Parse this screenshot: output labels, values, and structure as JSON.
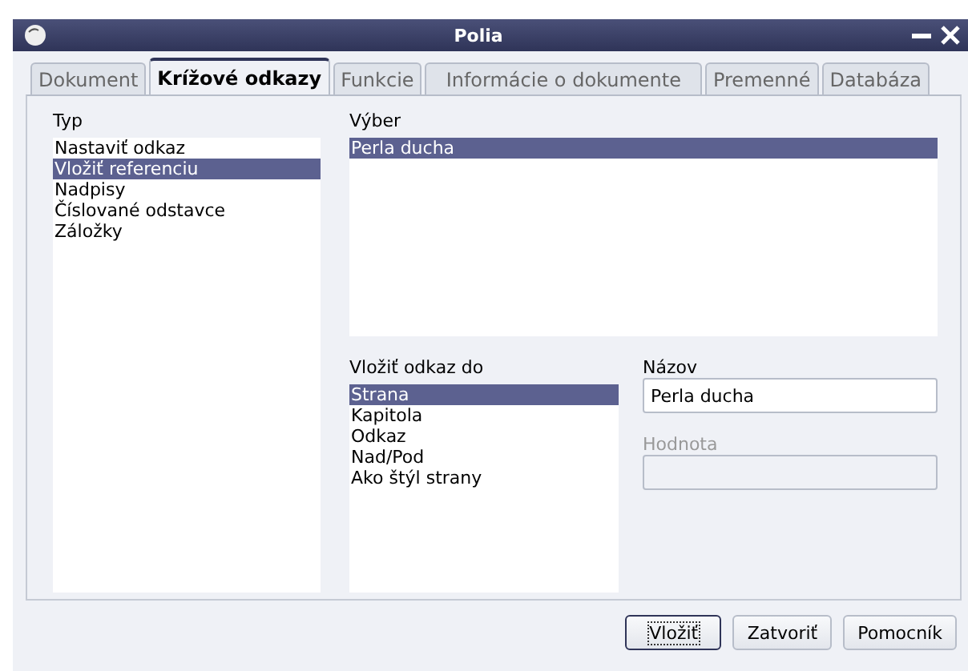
{
  "window": {
    "title": "Polia"
  },
  "tabs": [
    {
      "label": "Dokument",
      "selected": false
    },
    {
      "label": "Krížové odkazy",
      "selected": true
    },
    {
      "label": "Funkcie",
      "selected": false
    },
    {
      "label": "Informácie o dokumente",
      "selected": false
    },
    {
      "label": "Premenné",
      "selected": false
    },
    {
      "label": "Databáza",
      "selected": false
    }
  ],
  "type_list": {
    "label": "Typ",
    "items": [
      {
        "label": "Nastaviť odkaz",
        "selected": false
      },
      {
        "label": "Vložiť referenciu",
        "selected": true
      },
      {
        "label": "Nadpisy",
        "selected": false
      },
      {
        "label": "Číslované odstavce",
        "selected": false
      },
      {
        "label": "Záložky",
        "selected": false
      }
    ]
  },
  "selection_list": {
    "label": "Výber",
    "items": [
      {
        "label": "Perla ducha",
        "selected": true
      }
    ]
  },
  "insert_list": {
    "label": "Vložiť odkaz do",
    "items": [
      {
        "label": "Strana",
        "selected": true
      },
      {
        "label": "Kapitola",
        "selected": false
      },
      {
        "label": "Odkaz",
        "selected": false
      },
      {
        "label": "Nad/Pod",
        "selected": false
      },
      {
        "label": "Ako štýl strany",
        "selected": false
      }
    ]
  },
  "name_field": {
    "label": "Názov",
    "value": "Perla ducha"
  },
  "value_field": {
    "label": "Hodnota",
    "disabled": true
  },
  "buttons": [
    {
      "label": "Vložiť",
      "focused": true
    },
    {
      "label": "Zatvoriť",
      "focused": false
    },
    {
      "label": "Pomocník",
      "focused": false
    }
  ]
}
